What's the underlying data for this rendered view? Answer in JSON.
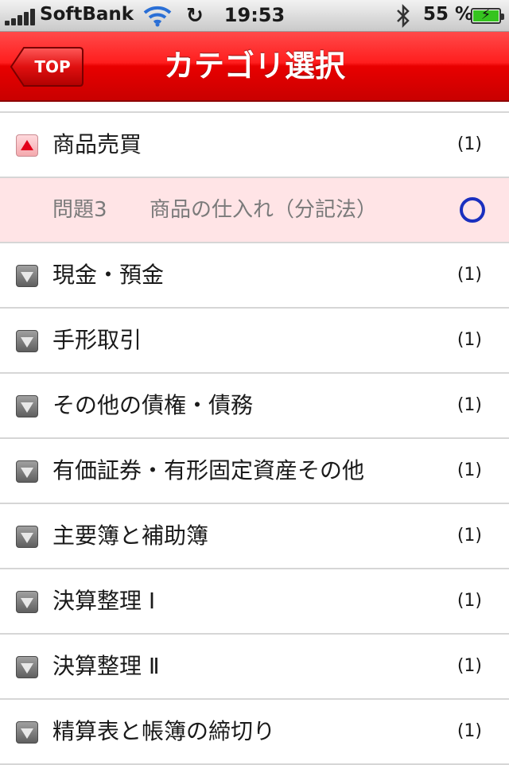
{
  "status_bar": {
    "carrier": "SoftBank",
    "time": "19:53",
    "battery": "55 %",
    "icons": [
      "signal-icon",
      "wifi-icon",
      "sync-icon",
      "bluetooth-icon",
      "battery-charging-icon"
    ]
  },
  "nav": {
    "back_label": "TOP",
    "title": "カテゴリ選択",
    "color": "#e80000"
  },
  "categories": [
    {
      "label": "商品売買",
      "count": "(1)",
      "expanded": true,
      "subitems": [
        {
          "number": "問題3",
          "title": "商品の仕入れ（分記法）",
          "status": "○"
        }
      ]
    },
    {
      "label": "現金・預金",
      "count": "(1)",
      "expanded": false
    },
    {
      "label": "手形取引",
      "count": "(1)",
      "expanded": false
    },
    {
      "label": "その他の債権・債務",
      "count": "(1)",
      "expanded": false
    },
    {
      "label": "有価証券・有形固定資産その他",
      "count": "(1)",
      "expanded": false
    },
    {
      "label": "主要簿と補助簿",
      "count": "(1)",
      "expanded": false
    },
    {
      "label": "決算整理 Ⅰ",
      "count": "(1)",
      "expanded": false
    },
    {
      "label": "決算整理 Ⅱ",
      "count": "(1)",
      "expanded": false
    },
    {
      "label": "精算表と帳簿の締切り",
      "count": "(1)",
      "expanded": false
    }
  ]
}
